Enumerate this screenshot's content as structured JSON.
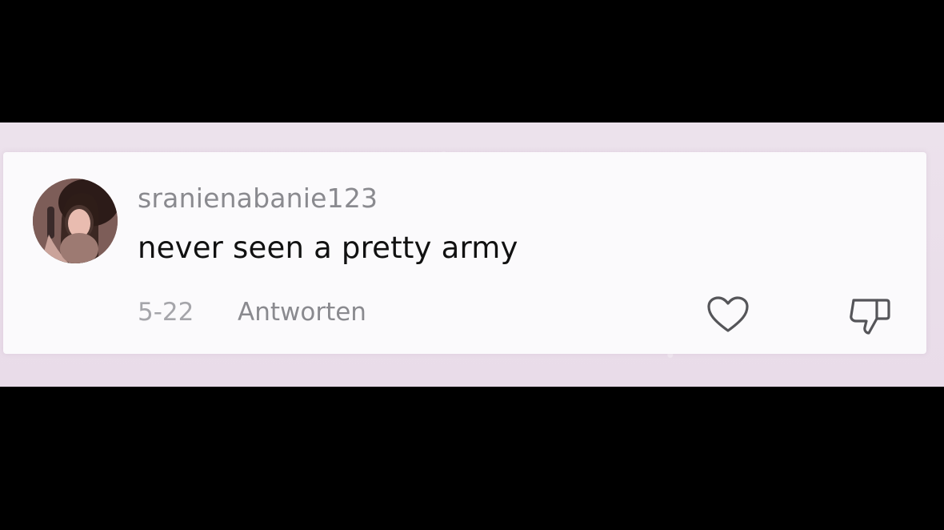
{
  "comment": {
    "username": "sranienabanie123",
    "text": "never seen a pretty army",
    "date": "5-22",
    "reply_label": "Antworten",
    "avatar_icon": "user-avatar",
    "like_icon": "heart-icon",
    "dislike_icon": "thumbs-down-icon"
  },
  "colors": {
    "background": "#000000",
    "band": "#ebe0eb",
    "card": "#fbfafc",
    "username": "#8a8a8f",
    "text": "#111111",
    "meta": "#a5a5aa"
  }
}
